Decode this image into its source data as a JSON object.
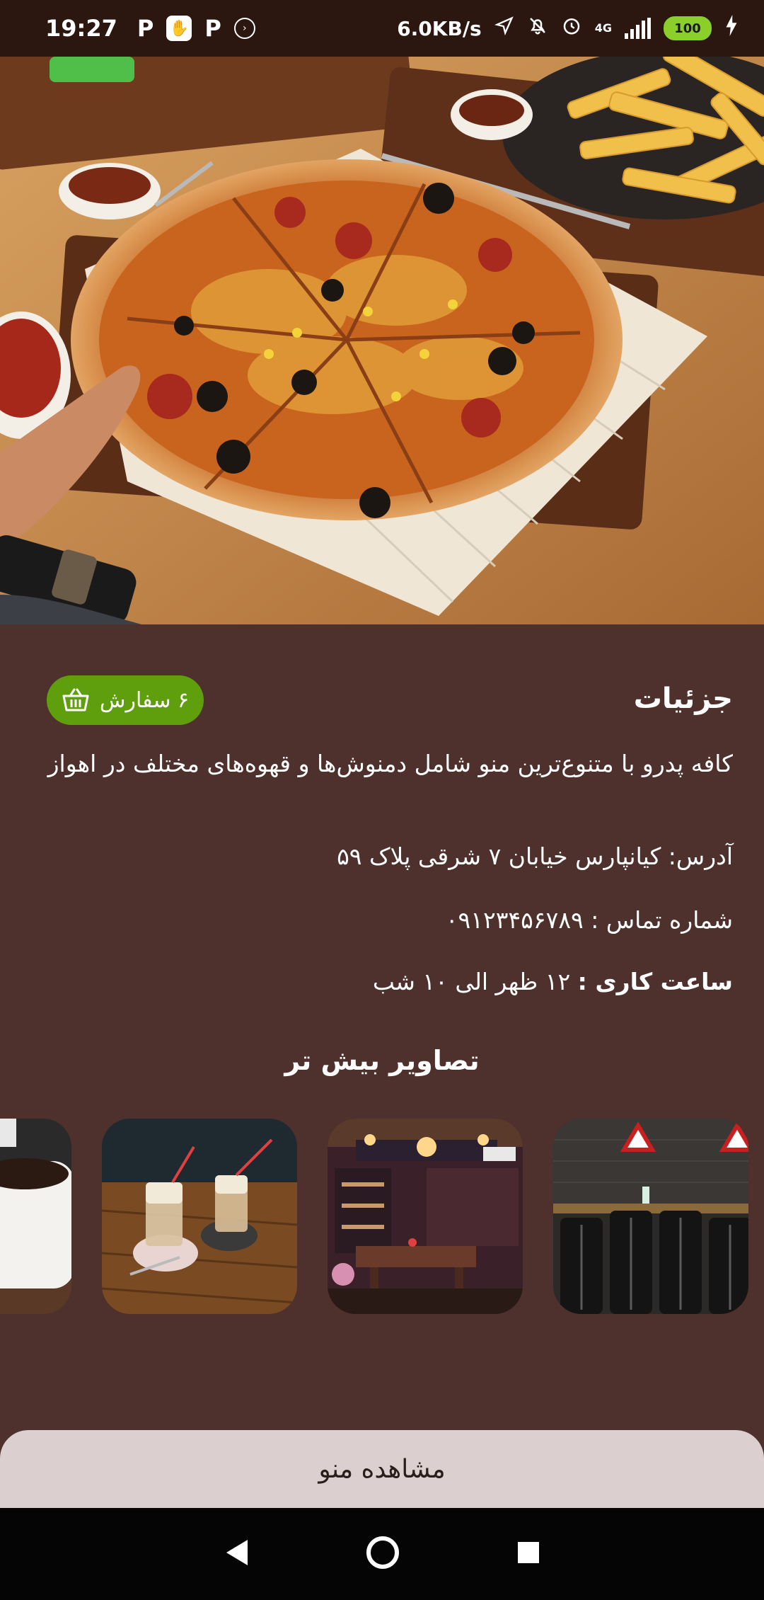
{
  "status_bar": {
    "time": "19:27",
    "app_icons": [
      "P",
      "P"
    ],
    "network_speed": "6.0KB/s",
    "network_type": "4G",
    "battery": "100",
    "icons": [
      "location-arrow-icon",
      "bell-off-icon",
      "alarm-icon",
      "signal-icon",
      "battery-icon",
      "charging-icon"
    ]
  },
  "hero": {
    "image": "pizza-photo"
  },
  "details": {
    "title": "جزئیات",
    "order_badge": "۶ سفارش",
    "description": "کافه پدرو با متنوع‌ترین منو شامل دمنوش‌ها و قهوه‌های مختلف در اهواز",
    "address": "آدرس: کیانپارس خیابان ۷ شرقی پلاک ۵۹",
    "phone": "شماره تماس : ۰۹۱۲۳۴۵۶۷۸۹",
    "hours_label": "ساعت کاری :",
    "hours_value": "۱۲ ظهر الی ۱۰ شب",
    "more_images_title": "تصاویر بیش تر"
  },
  "gallery": [
    {
      "name": "cafe-interior-chairs"
    },
    {
      "name": "cafe-interior-warm"
    },
    {
      "name": "iced-coffee-glasses"
    },
    {
      "name": "coffee-mug"
    }
  ],
  "menu_button": {
    "label": "مشاهده منو"
  },
  "nav": {
    "icons": [
      "back-icon",
      "home-icon",
      "recents-icon"
    ]
  },
  "colors": {
    "background": "#4e302c",
    "accent_green": "#5f9e0c",
    "button_bg": "#dbd0cf",
    "status_bar": "#2b1710"
  }
}
